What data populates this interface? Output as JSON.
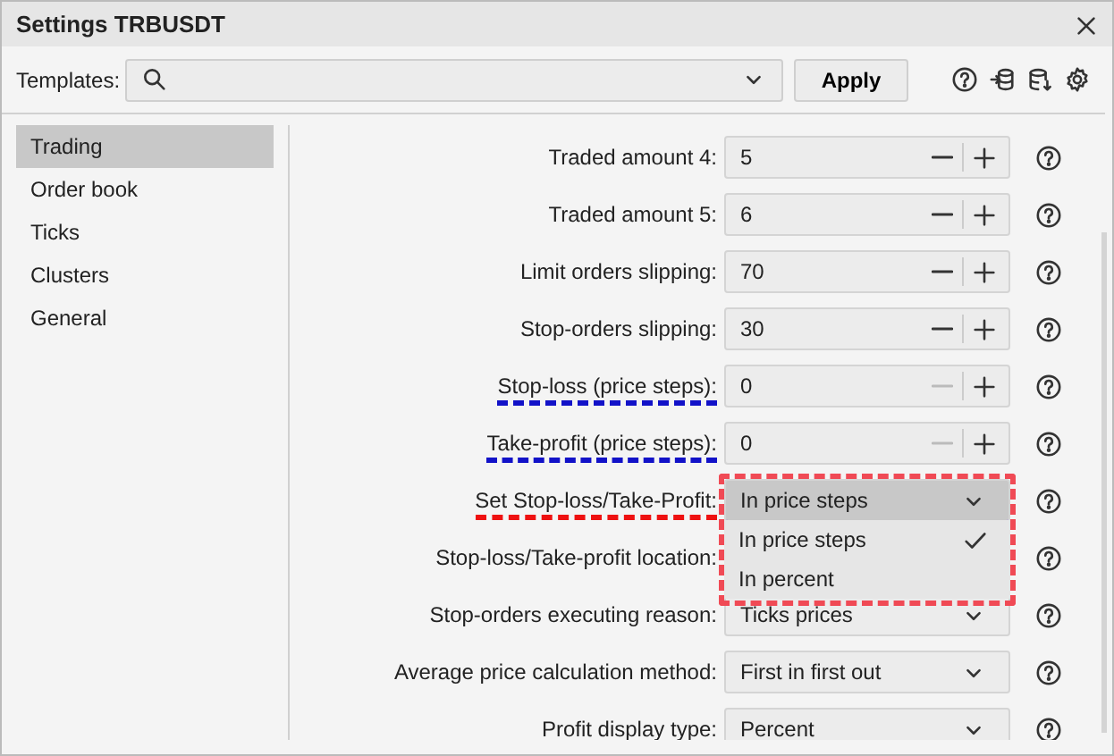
{
  "window": {
    "title": "Settings TRBUSDT"
  },
  "toolbar": {
    "label": "Templates:",
    "apply": "Apply"
  },
  "sidebar": {
    "items": [
      {
        "label": "Trading",
        "selected": true
      },
      {
        "label": "Order book",
        "selected": false
      },
      {
        "label": "Ticks",
        "selected": false
      },
      {
        "label": "Clusters",
        "selected": false
      },
      {
        "label": "General",
        "selected": false
      }
    ]
  },
  "rows": [
    {
      "kind": "spin",
      "label": "Traded amount  4:",
      "value": "5",
      "minus_disabled": false
    },
    {
      "kind": "spin",
      "label": "Traded amount  5:",
      "value": "6",
      "minus_disabled": false
    },
    {
      "kind": "spin",
      "label": "Limit orders slipping:",
      "value": "70",
      "minus_disabled": false
    },
    {
      "kind": "spin",
      "label": "Stop-orders slipping:",
      "value": "30",
      "minus_disabled": false
    },
    {
      "kind": "spin",
      "label": "Stop-loss (price steps):",
      "value": "0",
      "minus_disabled": true,
      "underline": {
        "color": "#1212c8"
      }
    },
    {
      "kind": "spin",
      "label": "Take-profit (price steps):",
      "value": "0",
      "minus_disabled": true,
      "underline": {
        "color": "#1212c8"
      }
    },
    {
      "kind": "select",
      "label": "Set Stop-loss/Take-Profit:",
      "value": "In price steps",
      "open": true,
      "underline": {
        "color": "#ee1111"
      },
      "frame": {
        "color": "#f04a55"
      },
      "options": [
        {
          "label": "In price steps",
          "selected": true
        },
        {
          "label": "In percent",
          "selected": false
        }
      ]
    },
    {
      "kind": "select",
      "label": "Stop-loss/Take-profit location:"
    },
    {
      "kind": "select",
      "label": "Stop-orders executing reason:",
      "value": "Ticks prices"
    },
    {
      "kind": "select",
      "label": "Average price calculation method:",
      "value": "First in first out"
    },
    {
      "kind": "select",
      "label": "Profit display type:",
      "value": "Percent"
    }
  ]
}
